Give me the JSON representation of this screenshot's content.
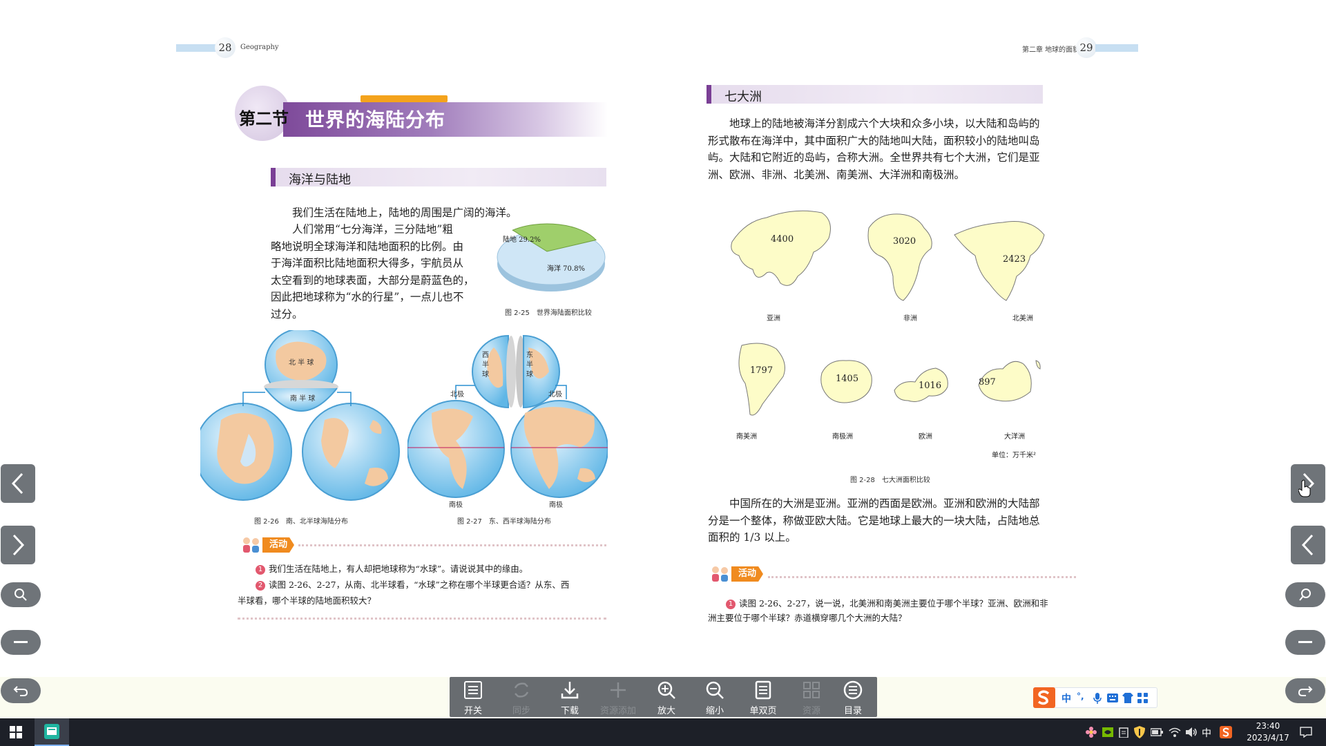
{
  "header": {
    "left_page_number": "28",
    "left_running_head": "Geography",
    "right_running_head": "第二章 地球的面貌",
    "right_page_number": "29"
  },
  "left_page": {
    "section_label": "第二节",
    "section_title": "世界的海陆分布",
    "subsection_title": "海洋与陆地",
    "para_1": "我们生活在陆地上，陆地的周围是广阔的海洋。",
    "para_2_lines": [
      "人们常用“七分海洋，三分陆地”粗",
      "略地说明全球海洋和陆地面积的比例。由",
      "于海洋面积比陆地面积大得多，宇航员从",
      "太空看到的地球表面，大部分是蔚蓝色的，",
      "因此把地球称为“水的行星”，一点儿也不",
      "过分。"
    ],
    "pie": {
      "land_label": "陆地 29.2%",
      "ocean_label": "海洋 70.8%",
      "land_percent": 29.2,
      "ocean_percent": 70.8,
      "caption": "图 2-25　世界海陆面积比较"
    },
    "fig26": {
      "caption": "图 2-26　南、北半球海陆分布",
      "north_hemisphere": "北 半 球",
      "south_hemisphere": "南 半 球"
    },
    "fig27": {
      "caption": "图 2-27　东、西半球海陆分布",
      "west_hemisphere": "西半球",
      "east_hemisphere": "东半球",
      "north_pole_left": "北极",
      "north_pole_right": "北极",
      "south_pole_left": "南极",
      "south_pole_right": "南极"
    },
    "activity_tag": "活动",
    "questions": [
      {
        "num": "1",
        "text": "我们生活在陆地上，有人却把地球称为“水球”。请说说其中的缘由。"
      },
      {
        "num": "2",
        "text": "读图 2-26、2-27，从南、北半球看，“水球”之称在哪个半球更合适？从东、西"
      },
      {
        "num": "",
        "text": "半球看，哪个半球的陆地面积较大？"
      }
    ]
  },
  "right_page": {
    "subsection_title": "七大洲",
    "para_1_lines": [
      "地球上的陆地被海洋分割成六个大块和众多小块，以大陆和岛屿的",
      "形式散布在海洋中，其中面积广大的陆地叫大陆，面积较小的陆地叫岛",
      "屿。大陆和它附近的岛屿，合称大洲。全世界共有七个大洲，它们是亚",
      "洲、欧洲、非洲、北美洲、南美洲、大洋洲和南极洲。"
    ],
    "continents": [
      {
        "name": "亚洲",
        "value": "4400"
      },
      {
        "name": "非洲",
        "value": "3020"
      },
      {
        "name": "北美洲",
        "value": "2423"
      },
      {
        "name": "南美洲",
        "value": "1797"
      },
      {
        "name": "南极洲",
        "value": "1405"
      },
      {
        "name": "欧洲",
        "value": "1016"
      },
      {
        "name": "大洋洲",
        "value": "897"
      }
    ],
    "unit": "单位：万千米²",
    "fig28_caption": "图 2-28　七大洲面积比较",
    "para_2_lines": [
      "中国所在的大洲是亚洲。亚洲的西面是欧洲。亚洲和欧洲的大陆部",
      "分是一个整体，称做亚欧大陆。它是地球上最大的一块大陆，占陆地总",
      "面积的 1/3 以上。"
    ],
    "activity_tag": "活动",
    "questions": [
      {
        "num": "1",
        "text": "读图 2-26、2-27，说一说，北美洲和南美洲主要位于哪个半球？亚洲、欧洲和非"
      },
      {
        "num": "",
        "text": "洲主要位于哪个半球？赤道横穿哪几个大洲的大陆？"
      }
    ]
  },
  "toolbar": {
    "items": [
      {
        "label": "开关",
        "icon": "toggle-panel-icon",
        "enabled": true
      },
      {
        "label": "同步",
        "icon": "sync-icon",
        "enabled": false
      },
      {
        "label": "下载",
        "icon": "download-icon",
        "enabled": true
      },
      {
        "label": "资源添加",
        "icon": "plus-icon",
        "enabled": false
      },
      {
        "label": "放大",
        "icon": "zoom-in-icon",
        "enabled": true
      },
      {
        "label": "缩小",
        "icon": "zoom-out-icon",
        "enabled": true
      },
      {
        "label": "单双页",
        "icon": "page-layout-icon",
        "enabled": true
      },
      {
        "label": "资源",
        "icon": "grid-icon",
        "enabled": false
      },
      {
        "label": "目录",
        "icon": "toc-icon",
        "enabled": true
      }
    ]
  },
  "ime": {
    "mode": "中",
    "punct": "°,"
  },
  "tray": {
    "lang": "中",
    "time": "23:40",
    "date": "2023/4/17"
  },
  "colors": {
    "nav_button": "#6f7479",
    "toolbar": "#686c70",
    "taskbar": "#1d2028",
    "section_purple": "#7e4a9a",
    "activity_orange": "#f08b1f"
  }
}
